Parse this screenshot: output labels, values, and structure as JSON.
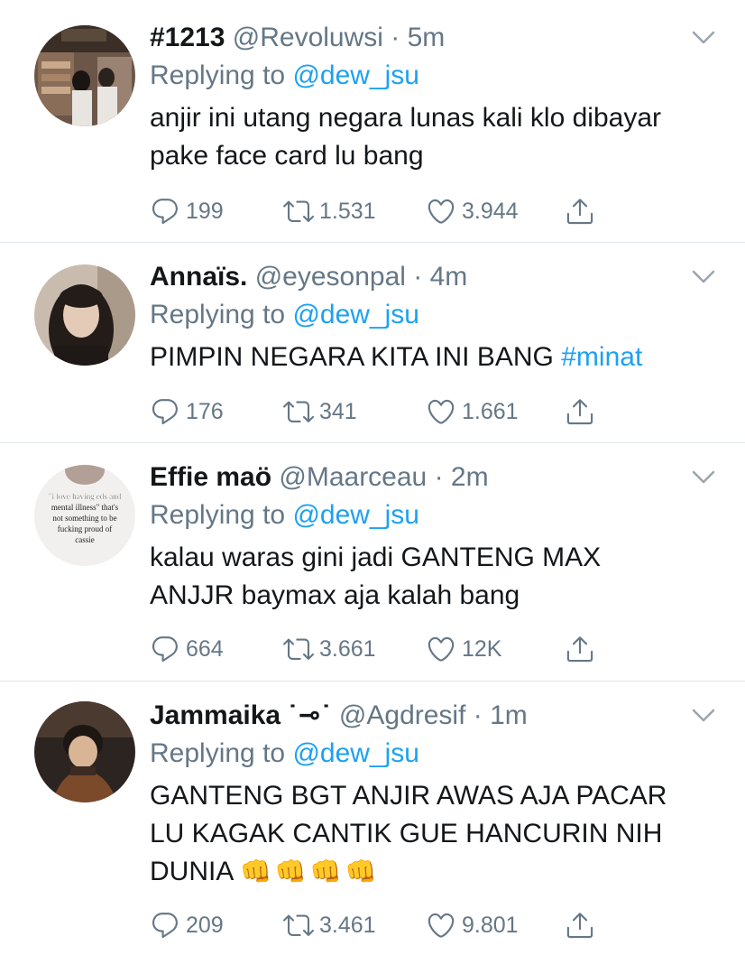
{
  "tweets": [
    {
      "name": "#1213",
      "handle": "@Revoluwsi",
      "time": "5m",
      "replying_prefix": "Replying to",
      "replying_to": "@dew_jsu",
      "lines": [
        "anjir ini utang negara lunas kali klo dibayar",
        "pake face card lu bang"
      ],
      "replies": "199",
      "retweets": "1.531",
      "likes": "3.944"
    },
    {
      "name": "Annaïs.",
      "handle": "@eyesonpal",
      "time": "4m",
      "replying_prefix": "Replying to",
      "replying_to": "@dew_jsu",
      "text": "PIMPIN NEGARA KITA INI BANG",
      "hashtag": "#minat",
      "replies": "176",
      "retweets": "341",
      "likes": "1.661"
    },
    {
      "name": "Effie maö",
      "handle": "@Maarceau",
      "time": "2m",
      "replying_prefix": "Replying to",
      "replying_to": "@dew_jsu",
      "avatar_caption": [
        "\"i love having eds and",
        "mental illness\" that's",
        "not something to be",
        "fucking proud of",
        "cassie"
      ],
      "lines": [
        "kalau waras gini jadi GANTENG MAX",
        "ANJJR baymax aja kalah bang"
      ],
      "replies": "664",
      "retweets": "3.661",
      "likes": "12K"
    },
    {
      "name": "Jammaika",
      "name_emote": "˙⊸˙",
      "handle": "@Agdresif",
      "time": "1m",
      "replying_prefix": "Replying to",
      "replying_to": "@dew_jsu",
      "lines": [
        "GANTENG BGT ANJIR AWAS AJA PACAR",
        "LU KAGAK CANTIK GUE HANCURIN NIH",
        "DUNIA"
      ],
      "emoji": "👊",
      "replies": "209",
      "retweets": "3.461",
      "likes": "9.801"
    }
  ],
  "icons": {
    "reply": "reply-icon",
    "retweet": "retweet-icon",
    "like": "heart-icon",
    "share": "share-icon",
    "menu": "chevron-down-icon"
  },
  "colors": {
    "text": "#14171a",
    "secondary": "#657786",
    "link": "#1da1f2",
    "divider": "#e1e8ed"
  }
}
